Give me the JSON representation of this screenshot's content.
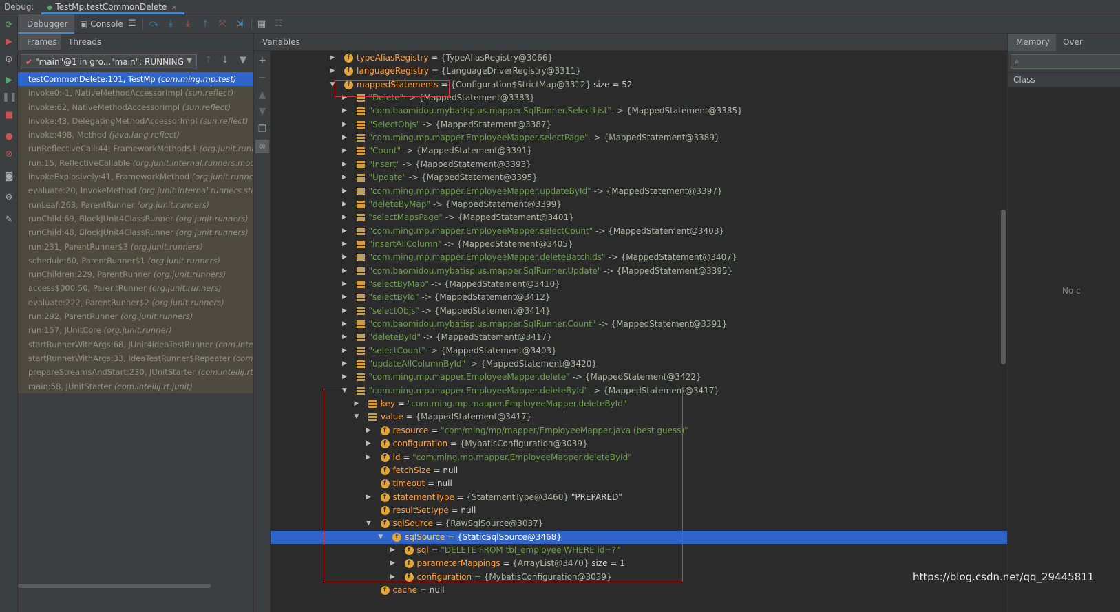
{
  "titlebar": {
    "label": "Debug:",
    "tab": "TestMp.testCommonDelete"
  },
  "debugger_tabs": {
    "debugger": "Debugger",
    "console": "Console"
  },
  "frames_panel": {
    "tab_frames": "Frames",
    "tab_threads": "Threads",
    "thread": "\"main\"@1 in gro...\"main\": RUNNING",
    "frames": [
      {
        "method": "testCommonDelete:101, TestMp",
        "pkg": "(com.ming.mp.test)"
      },
      {
        "method": "invoke0:-1, NativeMethodAccessorImpl",
        "pkg": "(sun.reflect)"
      },
      {
        "method": "invoke:62, NativeMethodAccessorImpl",
        "pkg": "(sun.reflect)"
      },
      {
        "method": "invoke:43, DelegatingMethodAccessorImpl",
        "pkg": "(sun.reflect)"
      },
      {
        "method": "invoke:498, Method",
        "pkg": "(java.lang.reflect)"
      },
      {
        "method": "runReflectiveCall:44, FrameworkMethod$1",
        "pkg": "(org.junit.runner"
      },
      {
        "method": "run:15, ReflectiveCallable",
        "pkg": "(org.junit.internal.runners.model)"
      },
      {
        "method": "invokeExplosively:41, FrameworkMethod",
        "pkg": "(org.junit.runners"
      },
      {
        "method": "evaluate:20, InvokeMethod",
        "pkg": "(org.junit.internal.runners.state"
      },
      {
        "method": "runLeaf:263, ParentRunner",
        "pkg": "(org.junit.runners)"
      },
      {
        "method": "runChild:69, BlockJUnit4ClassRunner",
        "pkg": "(org.junit.runners)"
      },
      {
        "method": "runChild:48, BlockJUnit4ClassRunner",
        "pkg": "(org.junit.runners)"
      },
      {
        "method": "run:231, ParentRunner$3",
        "pkg": "(org.junit.runners)"
      },
      {
        "method": "schedule:60, ParentRunner$1",
        "pkg": "(org.junit.runners)"
      },
      {
        "method": "runChildren:229, ParentRunner",
        "pkg": "(org.junit.runners)"
      },
      {
        "method": "access$000:50, ParentRunner",
        "pkg": "(org.junit.runners)"
      },
      {
        "method": "evaluate:222, ParentRunner$2",
        "pkg": "(org.junit.runners)"
      },
      {
        "method": "run:292, ParentRunner",
        "pkg": "(org.junit.runners)"
      },
      {
        "method": "run:157, JUnitCore",
        "pkg": "(org.junit.runner)"
      },
      {
        "method": "startRunnerWithArgs:68, JUnit4IdeaTestRunner",
        "pkg": "(com.intellij"
      },
      {
        "method": "startRunnerWithArgs:33, IdeaTestRunner$Repeater",
        "pkg": "(com.in"
      },
      {
        "method": "prepareStreamsAndStart:230, JUnitStarter",
        "pkg": "(com.intellij.rt.jun"
      },
      {
        "method": "main:58, JUnitStarter",
        "pkg": "(com.intellij.rt.junit)"
      }
    ]
  },
  "variables_panel": {
    "title": "Variables",
    "rows": [
      {
        "arrow": "right",
        "icon": "f",
        "name": "typeAliasRegistry",
        "eq": " = ",
        "ref": "{TypeAliasRegistry@3066}",
        "extra": ""
      },
      {
        "arrow": "right",
        "icon": "f",
        "name": "languageRegistry",
        "eq": " = ",
        "ref": "{LanguageDriverRegistry@3311}",
        "extra": ""
      },
      {
        "arrow": "down",
        "icon": "f",
        "name": "mappedStatements",
        "eq": " = ",
        "ref": "{Configuration$StrictMap@3312}",
        "extra": "  size = 52"
      },
      {
        "arrow": "right",
        "icon": "m",
        "str": "\"Delete\"",
        "ref": " -> {MappedStatement@3383}"
      },
      {
        "arrow": "right",
        "icon": "m",
        "str": "\"com.baomidou.mybatisplus.mapper.SqlRunner.SelectList\"",
        "ref": " -> {MappedStatement@3385}"
      },
      {
        "arrow": "right",
        "icon": "m",
        "str": "\"SelectObjs\"",
        "ref": " -> {MappedStatement@3387}"
      },
      {
        "arrow": "right",
        "icon": "m",
        "str": "\"com.ming.mp.mapper.EmployeeMapper.selectPage\"",
        "ref": " -> {MappedStatement@3389}"
      },
      {
        "arrow": "right",
        "icon": "m",
        "str": "\"Count\"",
        "ref": " -> {MappedStatement@3391}"
      },
      {
        "arrow": "right",
        "icon": "m",
        "str": "\"Insert\"",
        "ref": " -> {MappedStatement@3393}"
      },
      {
        "arrow": "right",
        "icon": "m",
        "str": "\"Update\"",
        "ref": " -> {MappedStatement@3395}"
      },
      {
        "arrow": "right",
        "icon": "m",
        "str": "\"com.ming.mp.mapper.EmployeeMapper.updateById\"",
        "ref": " -> {MappedStatement@3397}"
      },
      {
        "arrow": "right",
        "icon": "m",
        "str": "\"deleteByMap\"",
        "ref": " -> {MappedStatement@3399}"
      },
      {
        "arrow": "right",
        "icon": "m",
        "str": "\"selectMapsPage\"",
        "ref": " -> {MappedStatement@3401}"
      },
      {
        "arrow": "right",
        "icon": "m",
        "str": "\"com.ming.mp.mapper.EmployeeMapper.selectCount\"",
        "ref": " -> {MappedStatement@3403}"
      },
      {
        "arrow": "right",
        "icon": "m",
        "str": "\"insertAllColumn\"",
        "ref": " -> {MappedStatement@3405}"
      },
      {
        "arrow": "right",
        "icon": "m",
        "str": "\"com.ming.mp.mapper.EmployeeMapper.deleteBatchIds\"",
        "ref": " -> {MappedStatement@3407}"
      },
      {
        "arrow": "right",
        "icon": "m",
        "str": "\"com.baomidou.mybatisplus.mapper.SqlRunner.Update\"",
        "ref": " -> {MappedStatement@3395}"
      },
      {
        "arrow": "right",
        "icon": "m",
        "str": "\"selectByMap\"",
        "ref": " -> {MappedStatement@3410}"
      },
      {
        "arrow": "right",
        "icon": "m",
        "str": "\"selectById\"",
        "ref": " -> {MappedStatement@3412}"
      },
      {
        "arrow": "right",
        "icon": "m",
        "str": "\"selectObjs\"",
        "ref": " -> {MappedStatement@3414}"
      },
      {
        "arrow": "right",
        "icon": "m",
        "str": "\"com.baomidou.mybatisplus.mapper.SqlRunner.Count\"",
        "ref": " -> {MappedStatement@3391}"
      },
      {
        "arrow": "right",
        "icon": "m",
        "str": "\"deleteById\"",
        "ref": " -> {MappedStatement@3417}"
      },
      {
        "arrow": "right",
        "icon": "m",
        "str": "\"selectCount\"",
        "ref": " -> {MappedStatement@3403}"
      },
      {
        "arrow": "right",
        "icon": "m",
        "str": "\"updateAllColumnById\"",
        "ref": " -> {MappedStatement@3420}"
      },
      {
        "arrow": "right",
        "icon": "m",
        "str": "\"com.ming.mp.mapper.EmployeeMapper.delete\"",
        "ref": " -> {MappedStatement@3422}"
      },
      {
        "arrow": "down",
        "icon": "m",
        "str": "\"com.ming.mp.mapper.EmployeeMapper.deleteById\"",
        "ref": " -> {MappedStatement@3417}"
      },
      {
        "arrow": "right",
        "icon": "m",
        "name": "key",
        "eq": " = ",
        "str": "\"com.ming.mp.mapper.EmployeeMapper.deleteById\""
      },
      {
        "arrow": "down",
        "icon": "m",
        "name": "value",
        "eq": " = ",
        "ref": "{MappedStatement@3417}"
      },
      {
        "arrow": "right",
        "icon": "f",
        "name": "resource",
        "eq": " = ",
        "str": "\"com/ming/mp/mapper/EmployeeMapper.java (best guess)\""
      },
      {
        "arrow": "right",
        "icon": "f",
        "name": "configuration",
        "eq": " = ",
        "ref": "{MybatisConfiguration@3039}"
      },
      {
        "arrow": "right",
        "icon": "f",
        "name": "id",
        "eq": " = ",
        "str": "\"com.ming.mp.mapper.EmployeeMapper.deleteById\""
      },
      {
        "arrow": "none",
        "icon": "f",
        "name": "fetchSize",
        "eq": " = ",
        "plain": "null"
      },
      {
        "arrow": "none",
        "icon": "f",
        "name": "timeout",
        "eq": " = ",
        "plain": "null"
      },
      {
        "arrow": "right",
        "icon": "f",
        "name": "statementType",
        "eq": " = ",
        "ref": "{StatementType@3460}",
        "plain": " \"PREPARED\""
      },
      {
        "arrow": "none",
        "icon": "f",
        "name": "resultSetType",
        "eq": " = ",
        "plain": "null"
      },
      {
        "arrow": "down",
        "icon": "f",
        "name": "sqlSource",
        "eq": " = ",
        "ref": "{RawSqlSource@3037}"
      },
      {
        "arrow": "down",
        "icon": "f",
        "name": "sqlSource",
        "eq": " = ",
        "ref": "{StaticSqlSource@3468}"
      },
      {
        "arrow": "right",
        "icon": "f",
        "name": "sql",
        "eq": " = ",
        "str": "\"DELETE FROM tbl_employee WHERE id=?\""
      },
      {
        "arrow": "right",
        "icon": "f",
        "name": "parameterMappings",
        "eq": " = ",
        "ref": "{ArrayList@3470}",
        "plain": "  size = 1"
      },
      {
        "arrow": "right",
        "icon": "f",
        "name": "configuration",
        "eq": " = ",
        "ref": "{MybatisConfiguration@3039}"
      },
      {
        "arrow": "none",
        "icon": "f",
        "name": "cache",
        "eq": " = ",
        "plain": "null"
      }
    ]
  },
  "memory_panel": {
    "tab_memory": "Memory",
    "tab_overhead": "Over",
    "class_header": "Class",
    "empty_text": "No c"
  },
  "watermark": "https://blog.csdn.net/qq_29445811"
}
